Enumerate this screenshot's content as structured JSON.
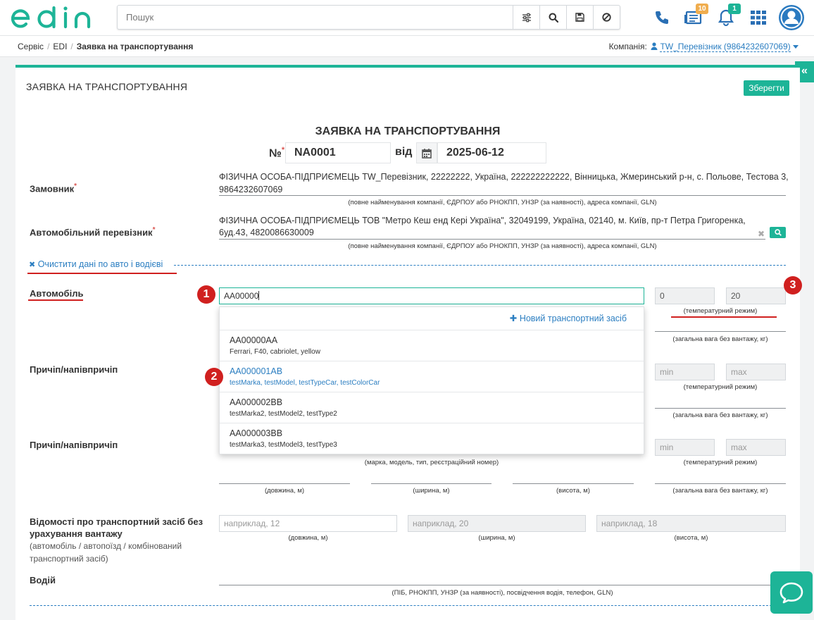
{
  "search": {
    "placeholder": "Пошук"
  },
  "header": {
    "logo": "edin",
    "archive_badge": "10",
    "bell_badge": "1",
    "colors": {
      "brand": "#1db497",
      "accent": "#2b7ec1",
      "badge_orange": "#f0ad4e",
      "badge_green": "#1db497"
    }
  },
  "breadcrumb": {
    "items": [
      "Сервіс",
      "EDI"
    ],
    "current": "Заявка на транспортування",
    "company_label": "Компанія:",
    "company_value": "TW_Перевізник (9864232607069)"
  },
  "page": {
    "title": "ЗАЯВКА НА ТРАНСПОРТУВАННЯ",
    "save_label": "Зберегти",
    "collapse_icon": "«"
  },
  "doc": {
    "title": "ЗАЯВКА НА ТРАНСПОРТУВАННЯ",
    "number_label": "№",
    "required_mark": "*",
    "number": "NA0001",
    "date_label": "від",
    "date": "2025-06-12"
  },
  "customer": {
    "label": "Замовник",
    "value_line1": "ФІЗИЧНА ОСОБА-ПІДПРИЄМЕЦЬ TW_Перевізник, 22222222, Україна, 222222222222, Вінницька, Жмеринський р-н, с. Польове, Тестова 3,",
    "value_line2": "9864232607069",
    "hint": "(повне найменування компанії, ЄДРПОУ або РНОКПП, УНЗР (за наявності), адреса компанії, GLN)"
  },
  "carrier": {
    "label": "Автомобільний перевізник",
    "value_line1": "ФІЗИЧНА ОСОБА-ПІДПРИЄМЕЦЬ ТОВ \"Метро Кеш енд Кері Україна\", 32049199, Україна, 02140, м. Київ, пр-т Петра Григоренка,",
    "value_line2": "6уд.43, 4820086630009",
    "hint": "(повне найменування компанії, ЄДРПОУ або РНОКПП, УНЗР (за наявності), адреса компанії, GLN)"
  },
  "clear_link": "Очистити дані по авто і водієві",
  "vehicle": {
    "label": "Автомобіль",
    "value": "AA00000",
    "temp_min": "0",
    "temp_max": "20",
    "temp_hint": "(температурний режим)",
    "weight_hint": "(загальна вага без вантажу, кг)"
  },
  "dropdown": {
    "new_label": "Новий транспортний засіб",
    "items": [
      {
        "title": "AA00000AA",
        "sub": "Ferrari, F40, cabriolet, yellow"
      },
      {
        "title": "AA000001AB",
        "sub": "testMarka, testModel, testTypeCar, testColorCar"
      },
      {
        "title": "AA000002BB",
        "sub": "testMarka2, testModel2, testType2"
      },
      {
        "title": "AA000003BB",
        "sub": "testMarka3, testModel3, testType3"
      }
    ]
  },
  "trailer1": {
    "label": "Причіп/напівпричіп",
    "min_placeholder": "min",
    "max_placeholder": "max",
    "temp_hint": "(температурний режим)",
    "weight_hint": "(загальна вага без вантажу, кг)"
  },
  "trailer2": {
    "label": "Причіп/напівпричіп",
    "min_placeholder": "min",
    "max_placeholder": "max",
    "desc_hint": "(марка, модель, тип, реєстраційний номер)",
    "temp_hint": "(температурний режим)",
    "length_hint": "(довжина, м)",
    "width_hint": "(ширина, м)",
    "height_hint": "(висота, м)",
    "weight_hint": "(загальна вага без вантажу, кг)"
  },
  "dimensions": {
    "label_line1": "Відомості про транспортний засіб без",
    "label_line2": "урахування вантажу",
    "sub_line1": "(автомобіль / автопоїзд / комбінований",
    "sub_line2": "транспортний засіб)",
    "length_placeholder": "наприклад, 12",
    "width_placeholder": "наприклад, 20",
    "height_placeholder": "наприклад, 18",
    "length_hint": "(довжина, м)",
    "width_hint": "(ширина, м)",
    "height_hint": "(висота, м)"
  },
  "driver": {
    "label": "Водій",
    "hint": "(ПІБ, РНОКПП, УНЗР (за наявності), посвідчення водія, телефон, GLN)"
  },
  "markers": [
    "1",
    "2",
    "3"
  ]
}
